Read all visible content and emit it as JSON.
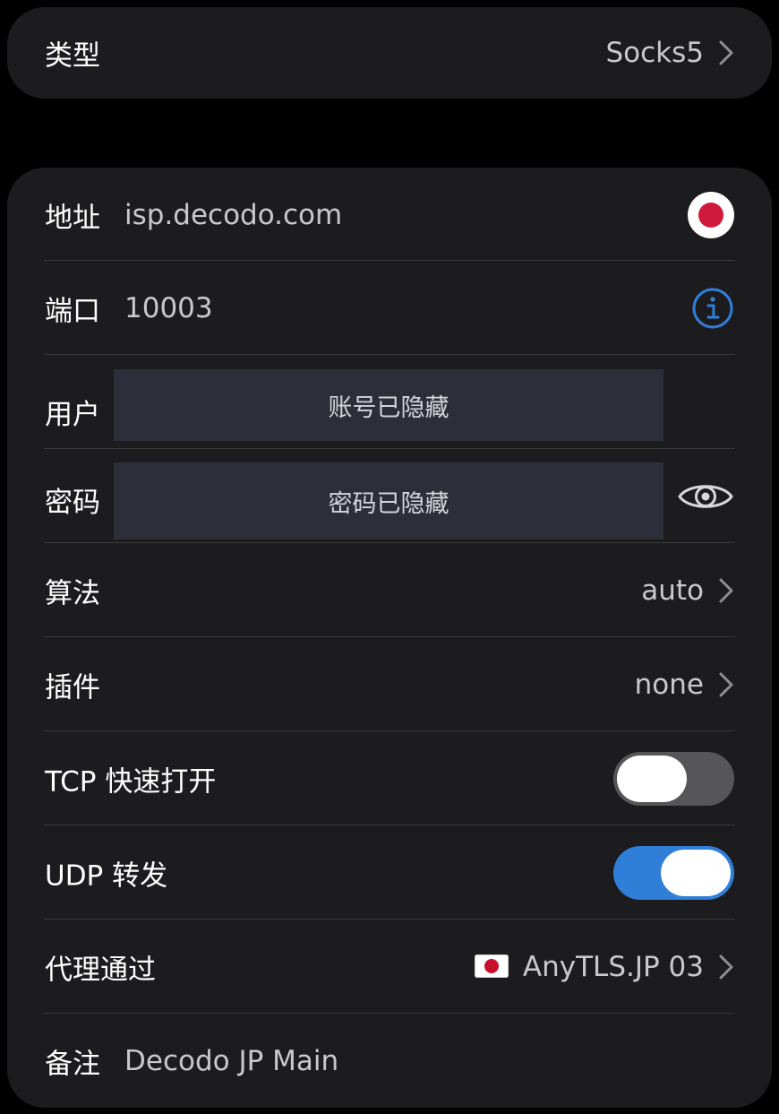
{
  "type_row": {
    "label": "类型",
    "value": "Socks5"
  },
  "fields": {
    "address": {
      "label": "地址",
      "value": "isp.decodo.com"
    },
    "port": {
      "label": "端口",
      "value": "10003"
    },
    "user": {
      "label": "用户",
      "hidden_text": "账号已隐藏"
    },
    "password": {
      "label": "密码",
      "hidden_text": "密码已隐藏"
    },
    "cipher": {
      "label": "算法",
      "value": "auto"
    },
    "plugin": {
      "label": "插件",
      "value": "none"
    },
    "tcp_fast_open": {
      "label": "TCP 快速打开",
      "enabled": false
    },
    "udp_relay": {
      "label": "UDP 转发",
      "enabled": true
    },
    "proxy_via": {
      "label": "代理通过",
      "value": "AnyTLS.JP 03",
      "flag": "japan-flag-icon"
    },
    "note": {
      "label": "备注",
      "value": "Decodo JP Main"
    }
  },
  "icons": {
    "record": "record-icon",
    "info": "info-icon",
    "eye": "eye-icon",
    "chevron": "chevron-right-icon"
  },
  "colors": {
    "background": "#000000",
    "card": "#1c1c1e",
    "separator": "#3a3a3c",
    "accent_blue": "#2f7ed8",
    "record_red": "#d01a3c",
    "toggle_off": "#565658",
    "hidden_box": "#2c2f3a"
  }
}
